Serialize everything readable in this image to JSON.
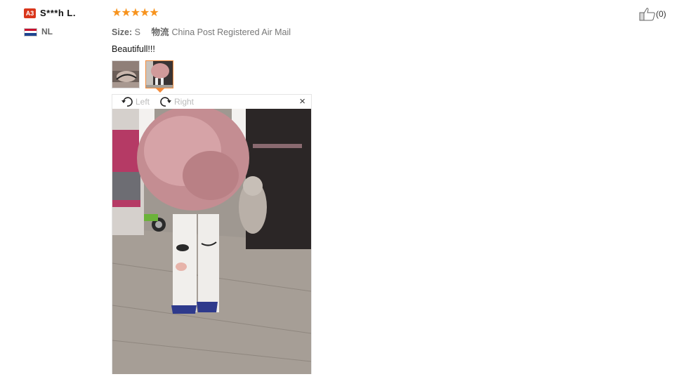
{
  "reviewer": {
    "badge": "A3",
    "name": "S***h L.",
    "country": "NL"
  },
  "review": {
    "rating": 5,
    "stars": "★★★★★",
    "size_label": "Size:",
    "size_value": "S",
    "logistics_label": "物流",
    "logistics_value": "China Post Registered Air Mail",
    "comment": "Beautifull!!!"
  },
  "viewer": {
    "rotate_left": "Left",
    "rotate_right": "Right",
    "close": "×"
  },
  "helpful": {
    "count": "(0)"
  },
  "colors": {
    "star": "#f7931d",
    "badge": "#d9361b",
    "active_border": "#f28a3a"
  }
}
